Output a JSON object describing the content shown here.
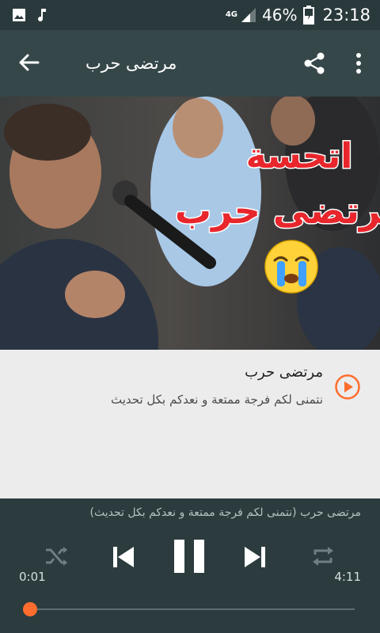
{
  "status_bar": {
    "network": "4G",
    "battery_percent": "46%",
    "time": "23:18",
    "icons": [
      "gallery-icon",
      "music-note-icon",
      "signal-icon",
      "battery-icon"
    ]
  },
  "toolbar": {
    "title": "مرتضى حرب",
    "back_icon": "arrow-back-icon",
    "share_icon": "share-icon",
    "more_icon": "more-vert-icon"
  },
  "cover": {
    "overlay_line1": "اتحسة",
    "overlay_line2": "مرتضى حرب",
    "emoji": "crying-face"
  },
  "song": {
    "title": "مرتضى حرب",
    "subtitle": "نتمنى لكم فرجة ممتعة و نعدكم بكل تحديث",
    "play_icon": "play-circle-icon"
  },
  "player": {
    "now_playing": "مرتضى حرب (نتمنى لكم فرجة ممتعة و نعدكم بكل تحديث)",
    "current_time": "0:01",
    "total_time": "4:11",
    "progress_fraction": 0.004,
    "accent_color": "#ff6d2e",
    "controls": [
      "shuffle-icon",
      "skip-previous-icon",
      "pause-icon",
      "skip-next-icon",
      "repeat-icon"
    ]
  }
}
